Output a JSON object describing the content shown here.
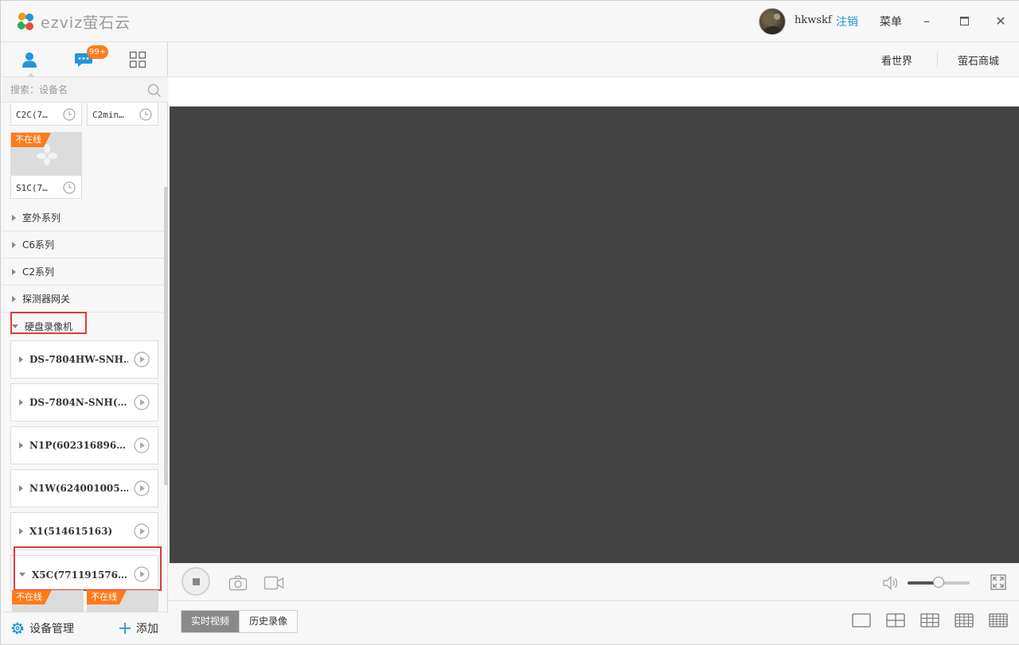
{
  "app": {
    "logo_text": "ezviz萤石云",
    "username": "hkwskf",
    "logout_label": "注销",
    "menu_label": "菜单",
    "minimize_glyph": "–",
    "maximize_glyph": "□",
    "close_glyph": "✕"
  },
  "sidebar": {
    "tabs": [
      {
        "name": "devices",
        "icon": "user-icon",
        "active": true
      },
      {
        "name": "messages",
        "icon": "chat-bubble-icon",
        "badge": "99+"
      },
      {
        "name": "apps",
        "icon": "grid-icon"
      }
    ],
    "search_placeholder": "搜索：设备名",
    "cards": [
      {
        "name": "C2C(7…",
        "offline": false
      },
      {
        "name": "C2min…",
        "offline": false
      },
      {
        "name": "S1C(7…",
        "offline": true,
        "status": "不在线"
      }
    ],
    "groups": [
      {
        "label": "室外系列",
        "expanded": false
      },
      {
        "label": "C6系列",
        "expanded": false
      },
      {
        "label": "C2系列",
        "expanded": false
      },
      {
        "label": "探测器网关",
        "expanded": false
      },
      {
        "label": "硬盘录像机",
        "expanded": true
      }
    ],
    "nvr_devices": [
      {
        "name": "DS-7804HW-SNH…",
        "expanded": false
      },
      {
        "name": "DS-7804N-SNH(…",
        "expanded": false
      },
      {
        "name": "N1P(602316896…",
        "expanded": false
      },
      {
        "name": "N1W(624001005…",
        "expanded": false
      },
      {
        "name": "X1(514615163)",
        "expanded": false
      },
      {
        "name": "X5C(771191576…",
        "expanded": true
      }
    ],
    "sub_cards_status": [
      "不在线",
      "不在线"
    ],
    "footer": {
      "manage_label": "设备管理",
      "add_label": "添加"
    }
  },
  "header_links": {
    "world_label": "看世界",
    "mall_label": "萤石商城"
  },
  "player": {
    "volume": 0.5
  },
  "bottom_bar": {
    "live_label": "实时视频",
    "history_label": "历史录像",
    "layouts": [
      "1x1",
      "2x2",
      "3x3",
      "4x4",
      "5x5"
    ]
  },
  "colors": {
    "accent_blue": "#2196d9",
    "offline_orange": "#ff7b1a",
    "highlight_red": "#e03a3a",
    "video_bg": "#434343"
  }
}
